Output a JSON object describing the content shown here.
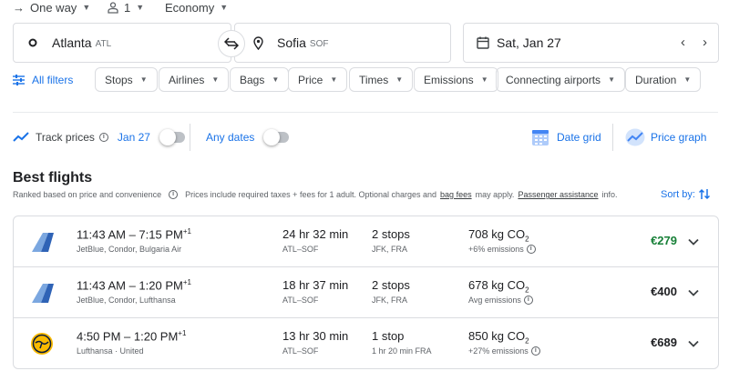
{
  "trip_options": {
    "trip_type": "One way",
    "passengers": "1",
    "cabin": "Economy"
  },
  "search": {
    "origin_city": "Atlanta",
    "origin_code": "ATL",
    "destination_city": "Sofia",
    "destination_code": "SOF",
    "date": "Sat, Jan 27"
  },
  "filters": {
    "all_filters_label": "All filters",
    "chips": [
      "Stops",
      "Airlines",
      "Bags",
      "Price",
      "Times",
      "Emissions",
      "Connecting airports",
      "Duration"
    ]
  },
  "tracking": {
    "track_label": "Track prices",
    "track_date": "Jan 27",
    "any_dates_label": "Any dates",
    "date_grid_label": "Date grid",
    "price_graph_label": "Price graph"
  },
  "results": {
    "title": "Best flights",
    "ranked_note": "Ranked based on price and convenience",
    "price_note": "Prices include required taxes + fees for 1 adult. Optional charges and",
    "bag_fees_link": "bag fees",
    "may_apply": "may apply.",
    "assistance_link": "Passenger assistance",
    "info_suffix": "info.",
    "sort_label": "Sort by:"
  },
  "flights": [
    {
      "time_depart": "11:43 AM – 7:15 PM",
      "day_offset": "+1",
      "airlines": "JetBlue, Condor, Bulgaria Air",
      "duration": "24 hr 32 min",
      "route": "ATL–SOF",
      "stops": "2 stops",
      "stop_info": "JFK, FRA",
      "co2_value": "708 kg CO",
      "co2_sub": "2",
      "emissions": "+6% emissions",
      "price": "€279"
    },
    {
      "time_depart": "11:43 AM – 1:20 PM",
      "day_offset": "+1",
      "airlines": "JetBlue, Condor, Lufthansa",
      "duration": "18 hr 37 min",
      "route": "ATL–SOF",
      "stops": "2 stops",
      "stop_info": "JFK, FRA",
      "co2_value": "678 kg CO",
      "co2_sub": "2",
      "emissions": "Avg emissions",
      "price": "€400"
    },
    {
      "time_depart": "4:50 PM – 1:20 PM",
      "day_offset": "+1",
      "airlines": "Lufthansa · United",
      "duration": "13 hr 30 min",
      "route": "ATL–SOF",
      "stops": "1 stop",
      "stop_info": "1 hr 20 min FRA",
      "co2_value": "850 kg CO",
      "co2_sub": "2",
      "emissions": "+27% emissions",
      "price": "€689"
    }
  ],
  "colors": {
    "accent": "#1a73e8",
    "price_low": "#188038",
    "border": "#dadce0"
  }
}
